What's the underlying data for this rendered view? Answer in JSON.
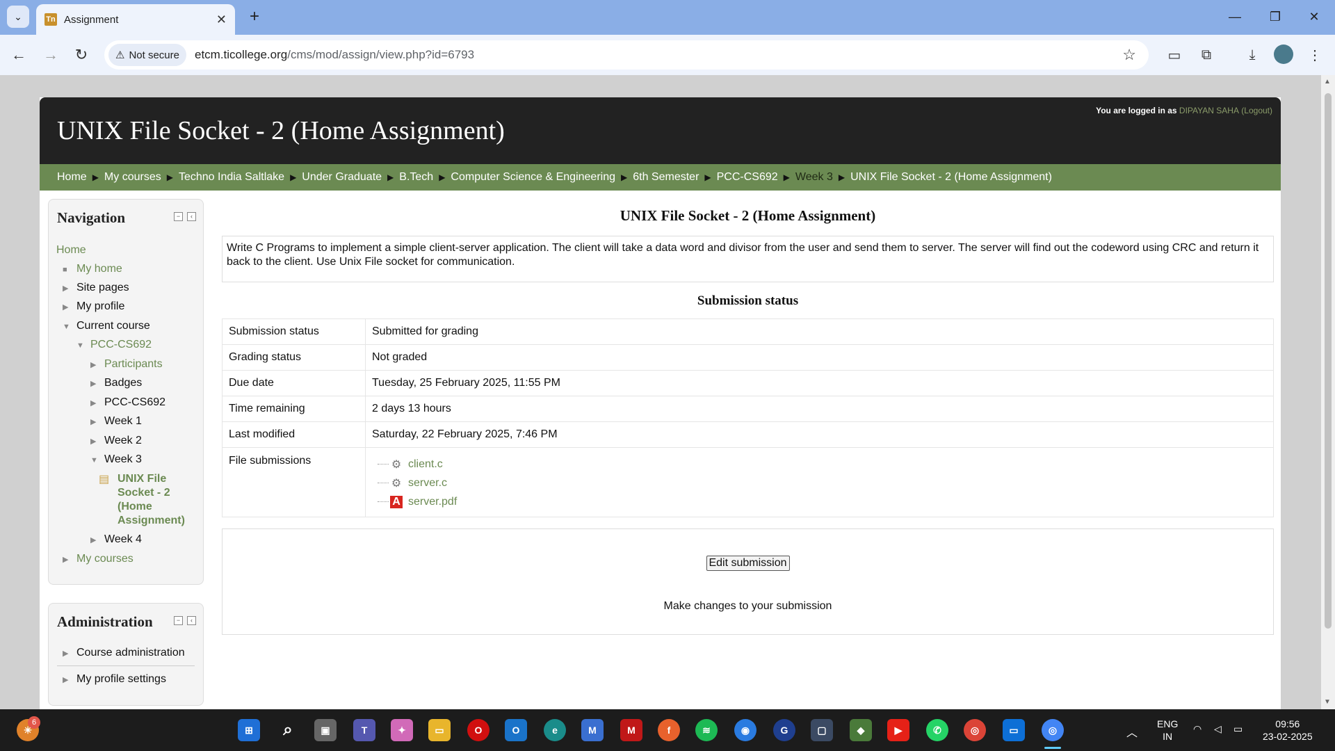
{
  "browser": {
    "tab_title": "Assignment",
    "tab_favicon": "Tn",
    "security_label": "Not secure",
    "url_host": "etcm.ticollege.org",
    "url_path": "/cms/mod/assign/view.php?id=6793"
  },
  "site": {
    "heading": "UNIX File Socket - 2 (Home Assignment)",
    "login_prefix": "You are logged in as",
    "user_name": "DIPAYAN SAHA",
    "logout_label": "Logout",
    "breadcrumbs": [
      "Home",
      "My courses",
      "Techno India Saltlake",
      "Under Graduate",
      "B.Tech",
      "Computer Science & Engineering",
      "6th Semester",
      "PCC-CS692",
      "Week 3",
      "UNIX File Socket - 2 (Home Assignment)"
    ]
  },
  "navigation": {
    "title": "Navigation",
    "home": "Home",
    "my_home": "My home",
    "site_pages": "Site pages",
    "my_profile": "My profile",
    "current_course": "Current course",
    "course": "PCC-CS692",
    "participants": "Participants",
    "badges": "Badges",
    "course_section": "PCC-CS692",
    "week1": "Week 1",
    "week2": "Week 2",
    "week3": "Week 3",
    "current_activity": "UNIX File Socket - 2 (Home Assignment)",
    "week4": "Week 4",
    "my_courses": "My courses"
  },
  "administration": {
    "title": "Administration",
    "course_admin": "Course administration",
    "profile_settings": "My profile settings"
  },
  "main": {
    "title": "UNIX File Socket - 2 (Home Assignment)",
    "description": "Write C Programs to implement a simple client-server application. The client will take a data word and divisor from the user and send them to server. The server will find out the codeword using CRC and return it back to the client. Use Unix File socket for communication.",
    "status_heading": "Submission status",
    "rows": [
      {
        "label": "Submission status",
        "value": "Submitted for grading"
      },
      {
        "label": "Grading status",
        "value": "Not graded"
      },
      {
        "label": "Due date",
        "value": "Tuesday, 25 February 2025, 11:55 PM"
      },
      {
        "label": "Time remaining",
        "value": "2 days 13 hours"
      },
      {
        "label": "Last modified",
        "value": "Saturday, 22 February 2025, 7:46 PM"
      }
    ],
    "files_label": "File submissions",
    "files": [
      "client.c",
      "server.c",
      "server.pdf"
    ],
    "edit_button": "Edit submission",
    "edit_desc": "Make changes to your submission"
  },
  "taskbar": {
    "widget_badge": "6",
    "lang": "ENG",
    "region": "IN",
    "time": "09:56",
    "date": "23-02-2025"
  },
  "colors": {
    "theme_green": "#6b8a52",
    "header_dark": "#222222",
    "chrome_blue": "#8aaee6"
  }
}
